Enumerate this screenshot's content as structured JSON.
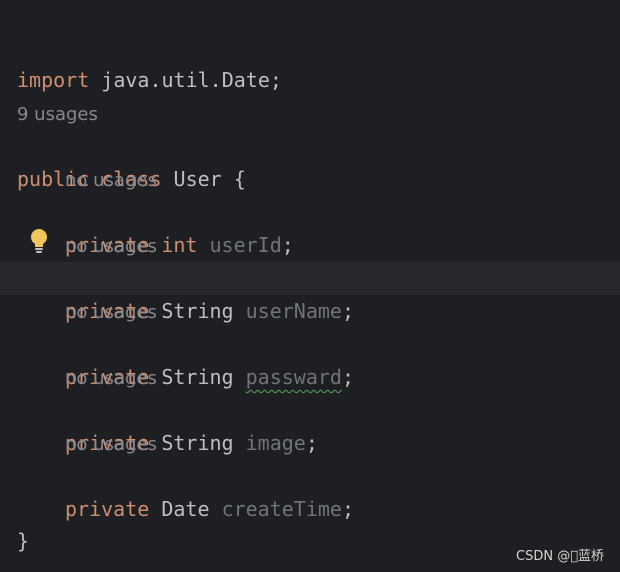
{
  "editor": {
    "lines": {
      "import_kw": "import",
      "import_path": " java.util.Date;",
      "class_usages": "9 usages",
      "class_kw1": "public",
      "class_kw2": "class",
      "class_name": " User {",
      "field_usages": "no usages",
      "private_kw": "private",
      "int_kw": "int",
      "string_type": "String",
      "date_type": "Date",
      "userId": "userId",
      "userName": "userName",
      "password": "passward",
      "image": "image",
      "createTime": "createTime",
      "semicolon": ";",
      "close_brace": "}"
    },
    "intention_icon": "lightbulb-icon",
    "colors": {
      "background": "#1e1f22",
      "current_line": "#26282e",
      "keyword": "#cf8e6d",
      "text": "#bcbec4",
      "unused_field": "#6f737a",
      "hint": "#86888f",
      "bulb": "#f2c55c",
      "typo_underline": "#5aa55a"
    }
  },
  "watermark": "CSDN @\u0000蓝桥"
}
